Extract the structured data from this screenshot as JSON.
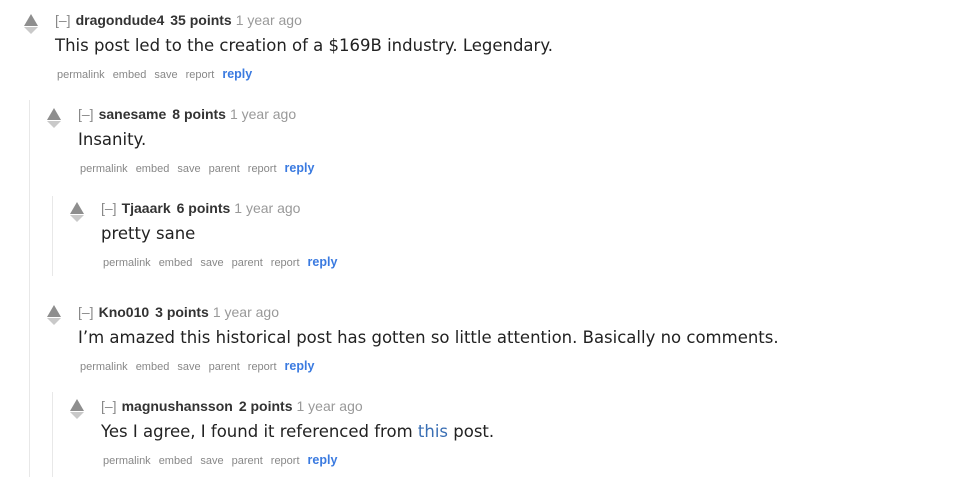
{
  "comments": [
    {
      "toggle": "[–]",
      "author": "dragondude4",
      "points": "35 points",
      "time": "1 year ago",
      "body": "This post led to the creation of a $169B industry. Legendary.",
      "buttons": [
        "permalink",
        "embed",
        "save",
        "report"
      ],
      "reply": "reply"
    },
    {
      "toggle": "[–]",
      "author": "sanesame",
      "points": "8 points",
      "time": "1 year ago",
      "body": "Insanity.",
      "buttons": [
        "permalink",
        "embed",
        "save",
        "parent",
        "report"
      ],
      "reply": "reply"
    },
    {
      "toggle": "[–]",
      "author": "Tjaaark",
      "points": "6 points",
      "time": "1 year ago",
      "body": "pretty sane",
      "buttons": [
        "permalink",
        "embed",
        "save",
        "parent",
        "report"
      ],
      "reply": "reply"
    },
    {
      "toggle": "[–]",
      "author": "Kno010",
      "points": "3 points",
      "time": "1 year ago",
      "body": "I’m amazed this historical post has gotten so little attention. Basically no comments.",
      "buttons": [
        "permalink",
        "embed",
        "save",
        "parent",
        "report"
      ],
      "reply": "reply"
    },
    {
      "toggle": "[–]",
      "author": "magnushansson",
      "points": "2 points",
      "time": "1 year ago",
      "body_before": "Yes I agree, I found it referenced from ",
      "body_link": "this",
      "body_after": " post.",
      "buttons": [
        "permalink",
        "embed",
        "save",
        "parent",
        "report"
      ],
      "reply": "reply"
    }
  ]
}
